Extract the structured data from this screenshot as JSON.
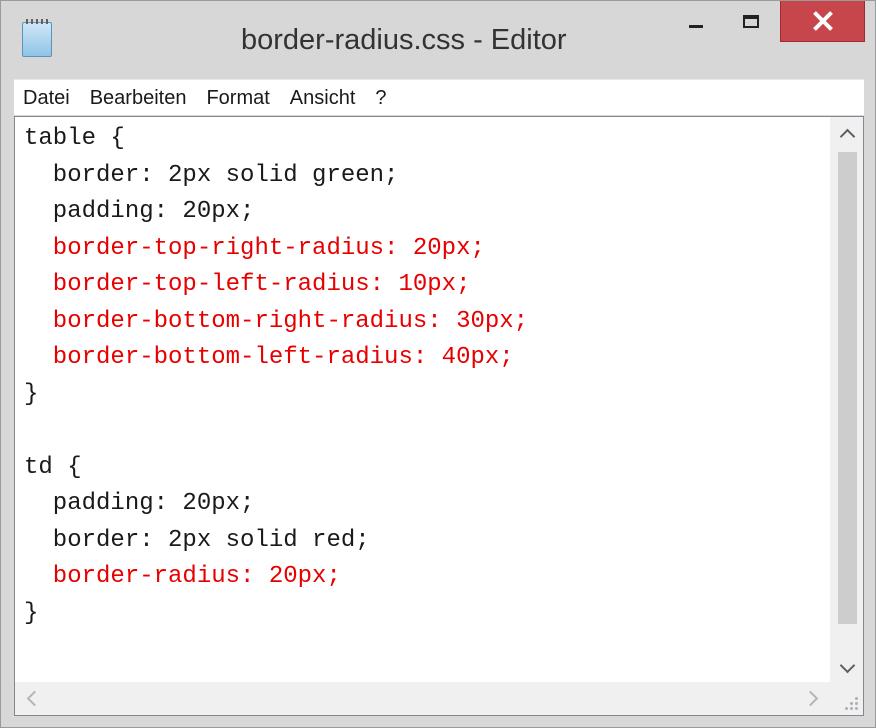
{
  "window": {
    "title": "border-radius.css - Editor",
    "close_color": "#c7464b",
    "icons": {
      "app": "notepad-icon",
      "minimize": "minimize-icon",
      "maximize": "maximize-icon",
      "close": "close-icon"
    }
  },
  "menu": {
    "items": [
      {
        "label": "Datei"
      },
      {
        "label": "Bearbeiten"
      },
      {
        "label": "Format"
      },
      {
        "label": "Ansicht"
      },
      {
        "label": "?"
      }
    ]
  },
  "editor": {
    "highlight_color": "#e60000",
    "lines": [
      {
        "text": "table {",
        "highlight": false
      },
      {
        "text": "  border: 2px solid green;",
        "highlight": false
      },
      {
        "text": "  padding: 20px;",
        "highlight": false
      },
      {
        "text": "  border-top-right-radius: 20px;",
        "highlight": true
      },
      {
        "text": "  border-top-left-radius: 10px;",
        "highlight": true
      },
      {
        "text": "  border-bottom-right-radius: 30px;",
        "highlight": true
      },
      {
        "text": "  border-bottom-left-radius: 40px;",
        "highlight": true
      },
      {
        "text": "}",
        "highlight": false
      },
      {
        "text": "",
        "highlight": false
      },
      {
        "text": "td {",
        "highlight": false
      },
      {
        "text": "  padding: 20px;",
        "highlight": false
      },
      {
        "text": "  border: 2px solid red;",
        "highlight": false
      },
      {
        "text": "  border-radius: 20px;",
        "highlight": true
      },
      {
        "text": "}",
        "highlight": false
      }
    ]
  },
  "scrollbars": {
    "icons": {
      "up": "chevron-up-icon",
      "down": "chevron-down-icon",
      "left": "chevron-left-icon",
      "right": "chevron-right-icon"
    }
  }
}
